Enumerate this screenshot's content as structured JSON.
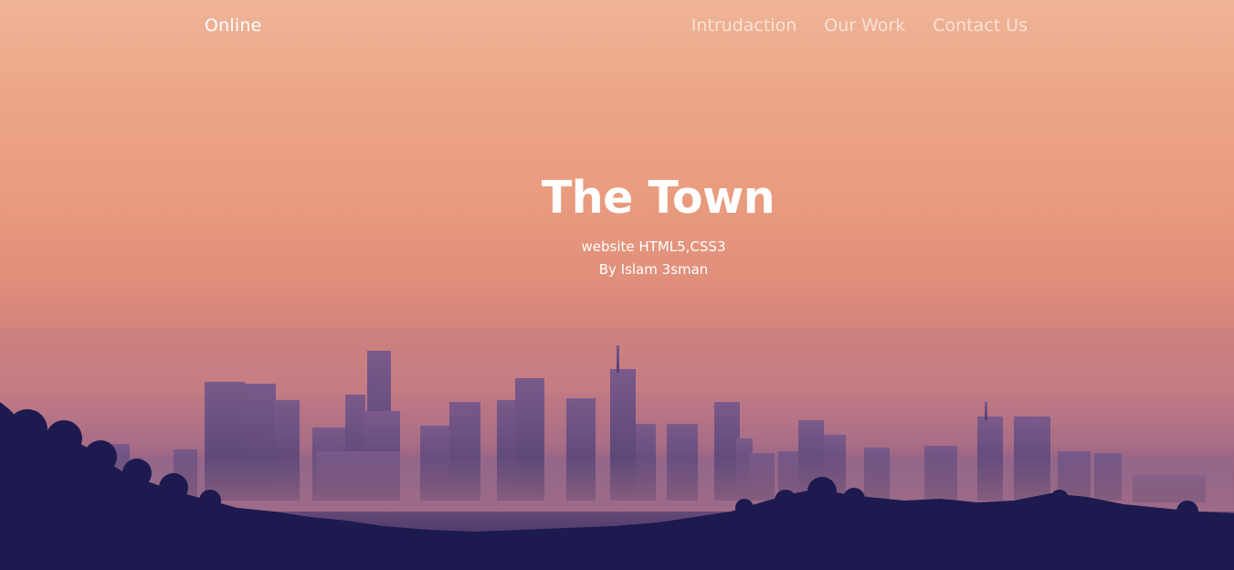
{
  "navbar": {
    "logo": "Online",
    "links": [
      "Intrudaction",
      "Our Work",
      "Contact Us"
    ]
  },
  "hero": {
    "title": "The Town",
    "subtitle_line1": "website HTML5,CSS3",
    "subtitle_line2": "By Islam 3sman"
  },
  "colors": {
    "sky_top": "#efb497",
    "sky_mid": "#df8e7b",
    "haze": "#c37b84",
    "buildings": "#5b4478",
    "hills": "#1c1a4e"
  }
}
